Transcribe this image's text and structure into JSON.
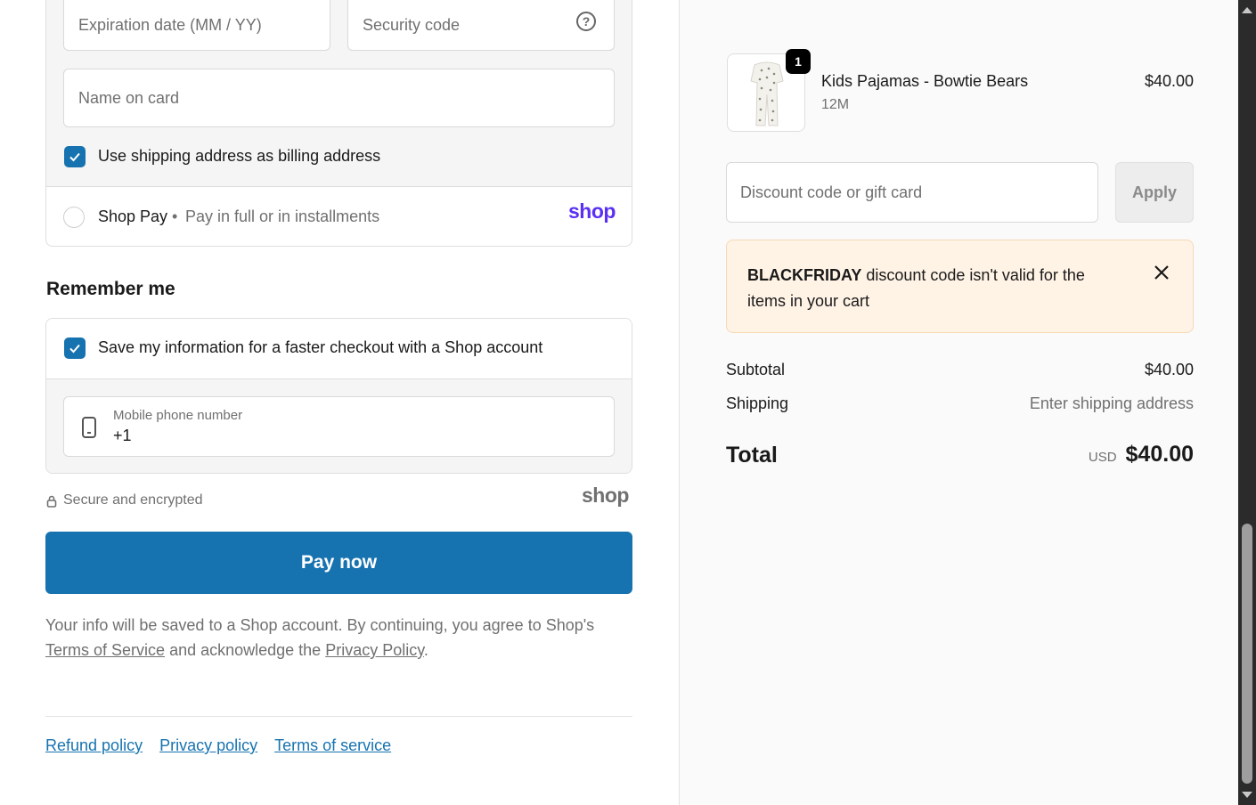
{
  "payment": {
    "expiration_placeholder": "Expiration date (MM / YY)",
    "security_placeholder": "Security code",
    "name_placeholder": "Name on card",
    "billing_checkbox_label": "Use shipping address as billing address",
    "shoppay_label": "Shop Pay",
    "shoppay_sub": "Pay in full or in installments",
    "shoppay_logo": "shop"
  },
  "remember": {
    "heading": "Remember me",
    "save_label": "Save my information for a faster checkout with a Shop account",
    "phone_label": "Mobile phone number",
    "phone_value": "+1"
  },
  "secure": {
    "text": "Secure and encrypted",
    "logo": "shop"
  },
  "pay_button": "Pay now",
  "consent": {
    "prefix": "Your info will be saved to a Shop account. By continuing, you agree to Shop's",
    "terms": "Terms of Service",
    "middle": "and acknowledge the",
    "privacy": "Privacy Policy",
    "suffix": "."
  },
  "footer_links": [
    "Refund policy",
    "Privacy policy",
    "Terms of service"
  ],
  "summary": {
    "item": {
      "name": "Kids Pajamas - Bowtie Bears",
      "variant": "12M",
      "price": "$40.00",
      "quantity": "1"
    },
    "discount_placeholder": "Discount code or gift card",
    "apply_label": "Apply",
    "error_code": "BLACKFRIDAY",
    "error_text": "discount code isn't valid for the items in your cart",
    "subtotal_label": "Subtotal",
    "subtotal_value": "$40.00",
    "shipping_label": "Shipping",
    "shipping_value": "Enter shipping address",
    "total_label": "Total",
    "currency": "USD",
    "total_value": "$40.00"
  },
  "colors": {
    "accent": "#1773b0",
    "shop_purple": "#5a31f4",
    "error_bg": "#fff3e6"
  }
}
